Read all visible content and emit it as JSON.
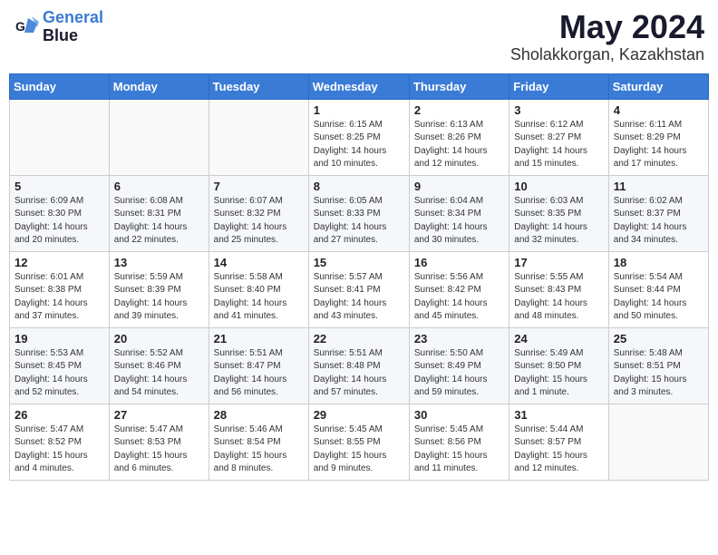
{
  "header": {
    "logo_line1": "General",
    "logo_line2": "Blue",
    "month_year": "May 2024",
    "location": "Sholakkorgan, Kazakhstan"
  },
  "days_of_week": [
    "Sunday",
    "Monday",
    "Tuesday",
    "Wednesday",
    "Thursday",
    "Friday",
    "Saturday"
  ],
  "weeks": [
    [
      {
        "day": "",
        "info": ""
      },
      {
        "day": "",
        "info": ""
      },
      {
        "day": "",
        "info": ""
      },
      {
        "day": "1",
        "info": "Sunrise: 6:15 AM\nSunset: 8:25 PM\nDaylight: 14 hours\nand 10 minutes."
      },
      {
        "day": "2",
        "info": "Sunrise: 6:13 AM\nSunset: 8:26 PM\nDaylight: 14 hours\nand 12 minutes."
      },
      {
        "day": "3",
        "info": "Sunrise: 6:12 AM\nSunset: 8:27 PM\nDaylight: 14 hours\nand 15 minutes."
      },
      {
        "day": "4",
        "info": "Sunrise: 6:11 AM\nSunset: 8:29 PM\nDaylight: 14 hours\nand 17 minutes."
      }
    ],
    [
      {
        "day": "5",
        "info": "Sunrise: 6:09 AM\nSunset: 8:30 PM\nDaylight: 14 hours\nand 20 minutes."
      },
      {
        "day": "6",
        "info": "Sunrise: 6:08 AM\nSunset: 8:31 PM\nDaylight: 14 hours\nand 22 minutes."
      },
      {
        "day": "7",
        "info": "Sunrise: 6:07 AM\nSunset: 8:32 PM\nDaylight: 14 hours\nand 25 minutes."
      },
      {
        "day": "8",
        "info": "Sunrise: 6:05 AM\nSunset: 8:33 PM\nDaylight: 14 hours\nand 27 minutes."
      },
      {
        "day": "9",
        "info": "Sunrise: 6:04 AM\nSunset: 8:34 PM\nDaylight: 14 hours\nand 30 minutes."
      },
      {
        "day": "10",
        "info": "Sunrise: 6:03 AM\nSunset: 8:35 PM\nDaylight: 14 hours\nand 32 minutes."
      },
      {
        "day": "11",
        "info": "Sunrise: 6:02 AM\nSunset: 8:37 PM\nDaylight: 14 hours\nand 34 minutes."
      }
    ],
    [
      {
        "day": "12",
        "info": "Sunrise: 6:01 AM\nSunset: 8:38 PM\nDaylight: 14 hours\nand 37 minutes."
      },
      {
        "day": "13",
        "info": "Sunrise: 5:59 AM\nSunset: 8:39 PM\nDaylight: 14 hours\nand 39 minutes."
      },
      {
        "day": "14",
        "info": "Sunrise: 5:58 AM\nSunset: 8:40 PM\nDaylight: 14 hours\nand 41 minutes."
      },
      {
        "day": "15",
        "info": "Sunrise: 5:57 AM\nSunset: 8:41 PM\nDaylight: 14 hours\nand 43 minutes."
      },
      {
        "day": "16",
        "info": "Sunrise: 5:56 AM\nSunset: 8:42 PM\nDaylight: 14 hours\nand 45 minutes."
      },
      {
        "day": "17",
        "info": "Sunrise: 5:55 AM\nSunset: 8:43 PM\nDaylight: 14 hours\nand 48 minutes."
      },
      {
        "day": "18",
        "info": "Sunrise: 5:54 AM\nSunset: 8:44 PM\nDaylight: 14 hours\nand 50 minutes."
      }
    ],
    [
      {
        "day": "19",
        "info": "Sunrise: 5:53 AM\nSunset: 8:45 PM\nDaylight: 14 hours\nand 52 minutes."
      },
      {
        "day": "20",
        "info": "Sunrise: 5:52 AM\nSunset: 8:46 PM\nDaylight: 14 hours\nand 54 minutes."
      },
      {
        "day": "21",
        "info": "Sunrise: 5:51 AM\nSunset: 8:47 PM\nDaylight: 14 hours\nand 56 minutes."
      },
      {
        "day": "22",
        "info": "Sunrise: 5:51 AM\nSunset: 8:48 PM\nDaylight: 14 hours\nand 57 minutes."
      },
      {
        "day": "23",
        "info": "Sunrise: 5:50 AM\nSunset: 8:49 PM\nDaylight: 14 hours\nand 59 minutes."
      },
      {
        "day": "24",
        "info": "Sunrise: 5:49 AM\nSunset: 8:50 PM\nDaylight: 15 hours\nand 1 minute."
      },
      {
        "day": "25",
        "info": "Sunrise: 5:48 AM\nSunset: 8:51 PM\nDaylight: 15 hours\nand 3 minutes."
      }
    ],
    [
      {
        "day": "26",
        "info": "Sunrise: 5:47 AM\nSunset: 8:52 PM\nDaylight: 15 hours\nand 4 minutes."
      },
      {
        "day": "27",
        "info": "Sunrise: 5:47 AM\nSunset: 8:53 PM\nDaylight: 15 hours\nand 6 minutes."
      },
      {
        "day": "28",
        "info": "Sunrise: 5:46 AM\nSunset: 8:54 PM\nDaylight: 15 hours\nand 8 minutes."
      },
      {
        "day": "29",
        "info": "Sunrise: 5:45 AM\nSunset: 8:55 PM\nDaylight: 15 hours\nand 9 minutes."
      },
      {
        "day": "30",
        "info": "Sunrise: 5:45 AM\nSunset: 8:56 PM\nDaylight: 15 hours\nand 11 minutes."
      },
      {
        "day": "31",
        "info": "Sunrise: 5:44 AM\nSunset: 8:57 PM\nDaylight: 15 hours\nand 12 minutes."
      },
      {
        "day": "",
        "info": ""
      }
    ]
  ]
}
